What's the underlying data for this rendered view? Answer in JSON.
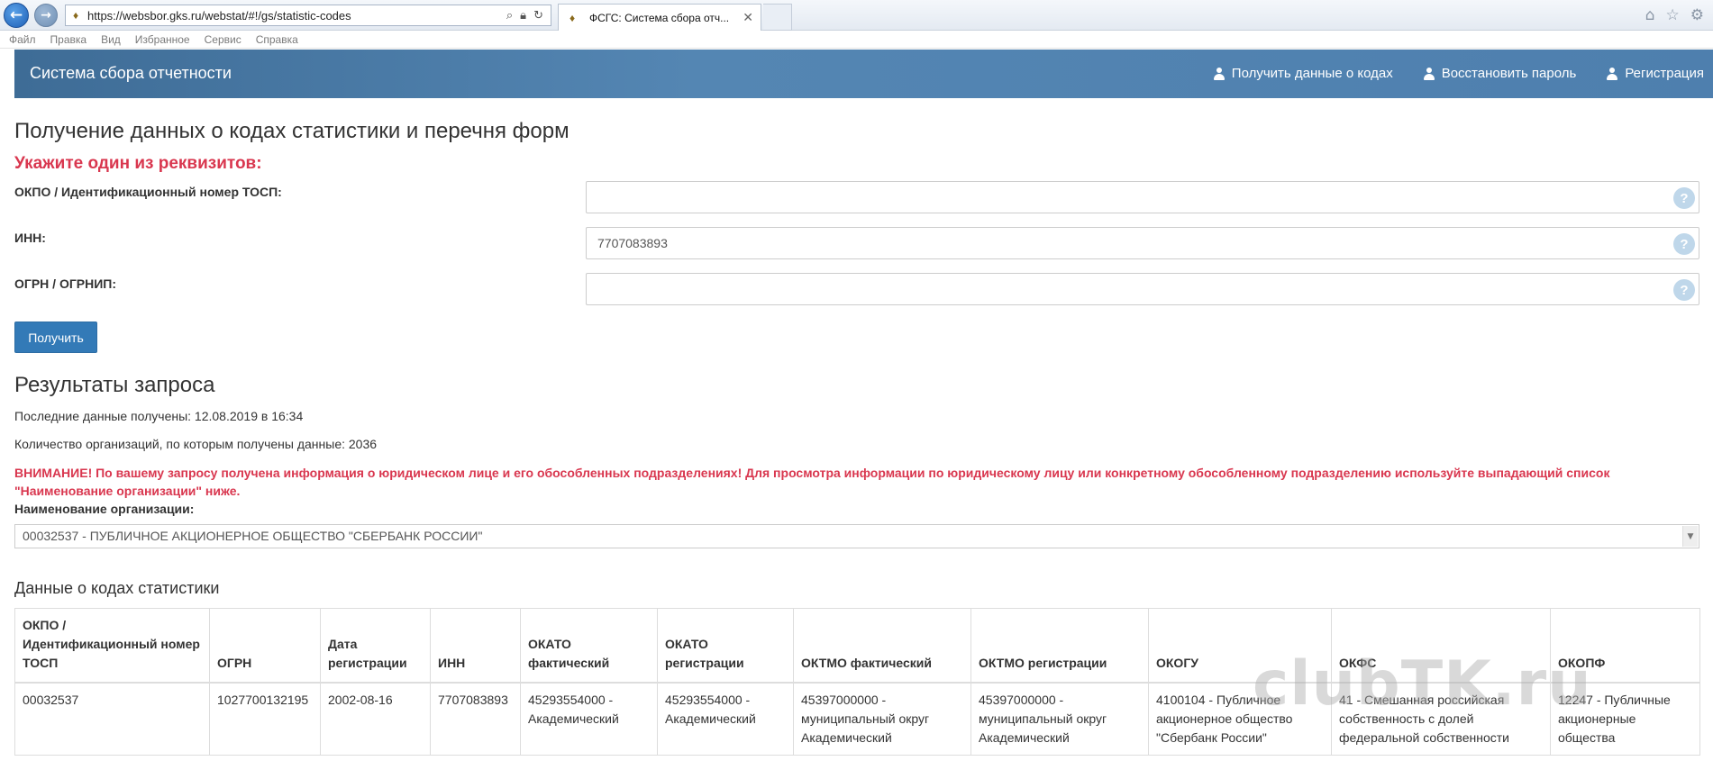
{
  "browser": {
    "url": "https://websbor.gks.ru/webstat/#!/gs/statistic-codes",
    "tab_title": "ФСГС: Система сбора отч...",
    "menu": [
      "Файл",
      "Правка",
      "Вид",
      "Избранное",
      "Сервис",
      "Справка"
    ]
  },
  "header": {
    "brand": "Система сбора отчетности",
    "nav": [
      "Получить данные о кодах",
      "Восстановить пароль",
      "Регистрация"
    ]
  },
  "form": {
    "title": "Получение данных о кодах статистики и перечня форм",
    "subtitle": "Укажите один из реквизитов:",
    "fields": [
      {
        "label": "ОКПО / Идентификационный номер ТОСП:",
        "value": ""
      },
      {
        "label": "ИНН:",
        "value": "7707083893"
      },
      {
        "label": "ОГРН / ОГРНИП:",
        "value": ""
      }
    ],
    "help": "?",
    "submit_label": "Получить"
  },
  "results": {
    "title": "Результаты запроса",
    "last_update": "Последние данные получены: 12.08.2019 в 16:34",
    "org_count": "Количество организаций, по которым получены данные: 2036",
    "warning": "ВНИМАНИЕ! По вашему запросу получена информация о юридическом лице и его обособленных подразделениях! Для просмотра информации по юридическому лицу или конкретному обособленному подразделению используйте выпадающий список \"Наименование организации\" ниже.",
    "org_label": "Наименование организации:",
    "org_selected": "00032537 - ПУБЛИЧНОЕ АКЦИОНЕРНОЕ ОБЩЕСТВО \"СБЕРБАНК РОССИИ\""
  },
  "codes": {
    "title": "Данные о кодах статистики",
    "columns": [
      "ОКПО / Идентификационный номер ТОСП",
      "ОГРН",
      "Дата регистрации",
      "ИНН",
      "ОКАТО фактический",
      "ОКАТО регистрации",
      "ОКТМО фактический",
      "ОКТМО регистрации",
      "ОКОГУ",
      "ОКФС",
      "ОКОПФ"
    ],
    "rows": [
      [
        "00032537",
        "1027700132195",
        "2002-08-16",
        "7707083893",
        "45293554000 - Академический",
        "45293554000 - Академический",
        "45397000000 - муниципальный округ Академический",
        "45397000000 - муниципальный округ Академический",
        "4100104 - Публичное акционерное общество \"Сбербанк России\"",
        "41 - Смешанная российская собственность с долей федеральной собственности",
        "12247 - Публичные акционерные общества"
      ]
    ]
  },
  "watermark": "clubTK.ru"
}
